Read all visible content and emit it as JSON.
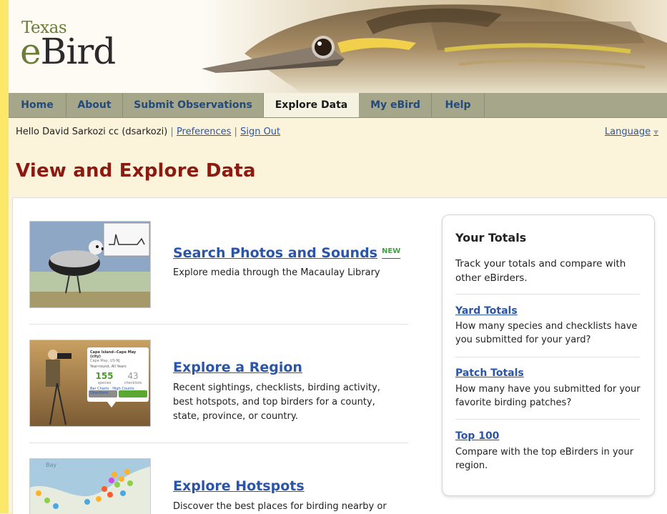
{
  "logo": {
    "small": "Texas",
    "big_e": "e",
    "big_rest": "Bird"
  },
  "nav": {
    "tabs": [
      {
        "label": "Home",
        "active": false
      },
      {
        "label": "About",
        "active": false
      },
      {
        "label": "Submit Observations",
        "active": false
      },
      {
        "label": "Explore Data",
        "active": true
      },
      {
        "label": "My eBird",
        "active": false
      },
      {
        "label": "Help",
        "active": false
      }
    ]
  },
  "user": {
    "greeting": "Hello David Sarkozi cc (dsarkozi)",
    "separator": "|",
    "preferences": "Preferences",
    "sign_out": "Sign Out",
    "language": "Language"
  },
  "page": {
    "title": "View and Explore Data"
  },
  "items": [
    {
      "title": "Search Photos and Sounds",
      "badge": "NEW",
      "desc": "Explore media through the Macaulay Library"
    },
    {
      "title": "Explore a Region",
      "desc": "Recent sightings, checklists, birding activity, best hotspots, and top birders for a county, state, province, or country."
    },
    {
      "title": "Explore Hotspots",
      "desc": "Discover the best places for birding nearby or"
    }
  ],
  "region_thumb": {
    "heading": "Cape Island--Cape May (city)",
    "sub": "Cape May, US-NJ",
    "filter": "Year-round, All Years",
    "species_count": "155",
    "species_label": "species",
    "checklist_count": "43",
    "checklist_label": "checklists",
    "links": "Bar Charts · High Counts · Directions",
    "btn_left": "Submit Data",
    "btn_right": "View Details"
  },
  "map_thumb": {
    "label": "Bay"
  },
  "totals": {
    "title": "Your Totals",
    "intro": "Track your totals and compare with other eBirders.",
    "links": [
      {
        "label": "Yard Totals",
        "desc": "How many species and checklists have you submitted for your yard?"
      },
      {
        "label": "Patch Totals",
        "desc": "How many have you submitted for your favorite birding patches?"
      },
      {
        "label": "Top 100",
        "desc": "Compare with the top eBirders in your region."
      }
    ]
  },
  "colors": {
    "title": "#8b1a10",
    "link": "#2a55a8",
    "nav": "#a5a68a",
    "page": "#fbf3da"
  }
}
